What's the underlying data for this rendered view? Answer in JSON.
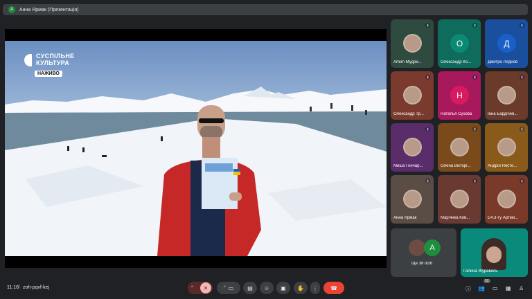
{
  "topbar": {
    "avatar_letter": "A",
    "title": "Анна Ярмак (Презентація)"
  },
  "presentation": {
    "logo_line1": "СУСПІЛЬНЕ",
    "logo_line2": "КУЛЬТУРА",
    "live_badge": "НАЖИВО"
  },
  "participants": [
    {
      "name": "Artem Мудри...",
      "type": "photo",
      "color": "#2f4b3f"
    },
    {
      "name": "Олександр Ко...",
      "type": "letter",
      "letter": "О",
      "bg": "#0f6b5c",
      "circle": "#0a8a74"
    },
    {
      "name": "Дмитро Ляднов",
      "type": "letter",
      "letter": "Д",
      "bg": "#1a4f9e",
      "circle": "#1a5fc8"
    },
    {
      "name": "Олександр Тр...",
      "type": "photo",
      "color": "#7a3a2e"
    },
    {
      "name": "Наталья Сухова",
      "type": "letter",
      "letter": "Н",
      "bg": "#a8185c",
      "circle": "#d81b60"
    },
    {
      "name": "Інна Бардічев...",
      "type": "photo",
      "color": "#6a3a2a"
    },
    {
      "name": "Миша Гончар...",
      "type": "photo",
      "color": "#5a2d6a"
    },
    {
      "name": "Олена Вікторі...",
      "type": "photo",
      "color": "#7a4a1a"
    },
    {
      "name": "Андрій Несте...",
      "type": "photo",
      "color": "#8a5a1a"
    },
    {
      "name": "Анна Ярмак",
      "type": "photo",
      "color": "#5a4d45"
    },
    {
      "name": "Мар'янка Ков...",
      "type": "photo",
      "color": "#6a3a32"
    },
    {
      "name": "Е4.3-ту Артем...",
      "type": "photo",
      "color": "#7a3a2a"
    }
  ],
  "more": {
    "letter": "А",
    "label": "Ще 38 осіб"
  },
  "last_tile": {
    "name": "Галина Журавель"
  },
  "bottombar": {
    "time": "11:16",
    "meeting_code": "zoh-pqvf-kej",
    "people_count": "52"
  }
}
